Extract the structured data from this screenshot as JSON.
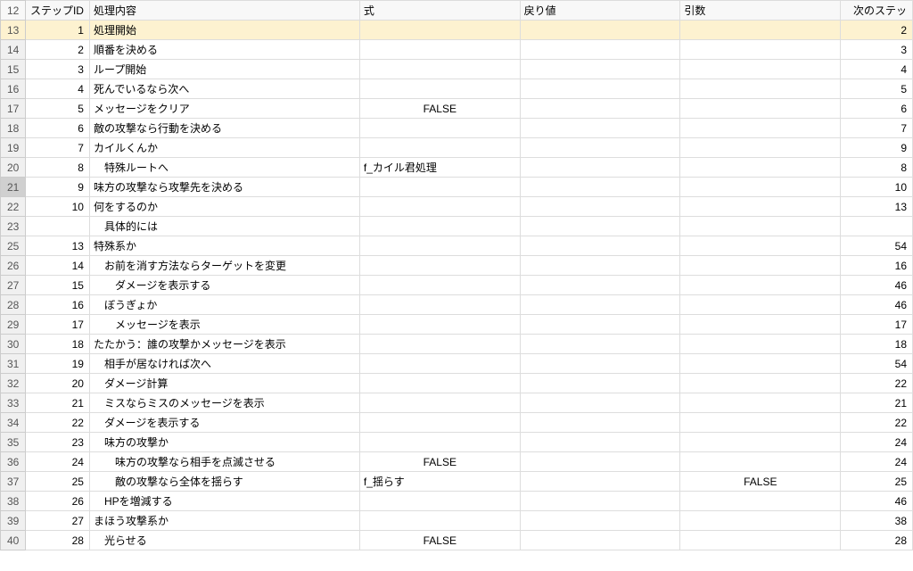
{
  "headers": {
    "stepid": "ステップID",
    "content": "処理内容",
    "formula": "式",
    "return": "戻り値",
    "args": "引数",
    "next": "次のステッ"
  },
  "rows": [
    {
      "rownum": "12",
      "header": true
    },
    {
      "rownum": "13",
      "stepid": "1",
      "content": "処理開始",
      "next": "2",
      "highlighted": true
    },
    {
      "rownum": "14",
      "stepid": "2",
      "content": "順番を決める",
      "next": "3"
    },
    {
      "rownum": "15",
      "stepid": "3",
      "content": "ループ開始",
      "next": "4"
    },
    {
      "rownum": "16",
      "stepid": "4",
      "content": "死んでいるなら次へ",
      "next": "5"
    },
    {
      "rownum": "17",
      "stepid": "5",
      "content": "メッセージをクリア",
      "formula": "FALSE",
      "next": "6"
    },
    {
      "rownum": "18",
      "stepid": "6",
      "content": "敵の攻撃なら行動を決める",
      "next": "7"
    },
    {
      "rownum": "19",
      "stepid": "7",
      "content": "カイルくんか",
      "next": "9"
    },
    {
      "rownum": "20",
      "stepid": "8",
      "content": "特殊ルートへ",
      "indent": 1,
      "formula": "f_カイル君処理",
      "next": "8"
    },
    {
      "rownum": "21",
      "stepid": "9",
      "content": "味方の攻撃なら攻撃先を決める",
      "next": "10",
      "selected": true
    },
    {
      "rownum": "22",
      "stepid": "10",
      "content": "何をするのか",
      "next": "13"
    },
    {
      "rownum": "23",
      "stepid": "",
      "content": "具体的には",
      "indent": 1
    },
    {
      "rownum": "25",
      "stepid": "13",
      "content": "特殊系か",
      "next": "54"
    },
    {
      "rownum": "26",
      "stepid": "14",
      "content": "お前を消す方法ならターゲットを変更",
      "indent": 1,
      "next": "16"
    },
    {
      "rownum": "27",
      "stepid": "15",
      "content": "ダメージを表示する",
      "indent": 2,
      "next": "46"
    },
    {
      "rownum": "28",
      "stepid": "16",
      "content": "ぼうぎょか",
      "indent": 1,
      "next": "46"
    },
    {
      "rownum": "29",
      "stepid": "17",
      "content": "メッセージを表示",
      "indent": 2,
      "next": "17"
    },
    {
      "rownum": "30",
      "stepid": "18",
      "content": "たたかう：誰の攻撃かメッセージを表示",
      "next": "18"
    },
    {
      "rownum": "31",
      "stepid": "19",
      "content": "相手が居なければ次へ",
      "indent": 1,
      "next": "54"
    },
    {
      "rownum": "32",
      "stepid": "20",
      "content": "ダメージ計算",
      "indent": 1,
      "next": "22"
    },
    {
      "rownum": "33",
      "stepid": "21",
      "content": "ミスならミスのメッセージを表示",
      "indent": 1,
      "next": "21"
    },
    {
      "rownum": "34",
      "stepid": "22",
      "content": "ダメージを表示する",
      "indent": 1,
      "next": "22"
    },
    {
      "rownum": "35",
      "stepid": "23",
      "content": "味方の攻撃か",
      "indent": 1,
      "next": "24"
    },
    {
      "rownum": "36",
      "stepid": "24",
      "content": "味方の攻撃なら相手を点滅させる",
      "indent": 2,
      "formula": "FALSE",
      "next": "24"
    },
    {
      "rownum": "37",
      "stepid": "25",
      "content": "敵の攻撃なら全体を揺らす",
      "indent": 2,
      "formula": "f_揺らす",
      "args": "FALSE",
      "next": "25"
    },
    {
      "rownum": "38",
      "stepid": "26",
      "content": "HPを増減する",
      "indent": 1,
      "next": "46"
    },
    {
      "rownum": "39",
      "stepid": "27",
      "content": "まほう攻撃系か",
      "next": "38"
    },
    {
      "rownum": "40",
      "stepid": "28",
      "content": "光らせる",
      "indent": 1,
      "formula": "FALSE",
      "next": "28"
    }
  ]
}
